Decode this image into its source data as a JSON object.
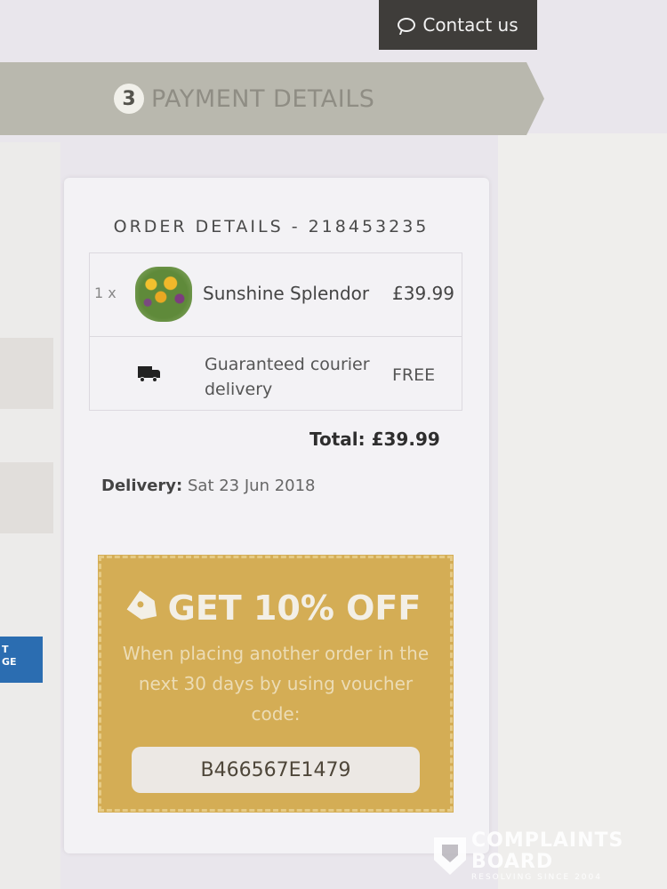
{
  "header": {
    "contact_button": "Contact us",
    "step_number": "3",
    "step_title": "PAYMENT DETAILS"
  },
  "order": {
    "title": "ORDER DETAILS - 218453235",
    "items": [
      {
        "qty": "1 x",
        "name": "Sunshine Splendor",
        "price": "£39.99"
      }
    ],
    "delivery_line": {
      "name": "Guaranteed courier delivery",
      "price": "FREE"
    },
    "total": "Total: £39.99",
    "delivery_label": "Delivery:",
    "delivery_date": "Sat 23 Jun 2018"
  },
  "voucher": {
    "headline": "GET 10% OFF",
    "text": "When placing another order in the next 30 days by using voucher code:",
    "code": "B466567E1479"
  },
  "side_badge": {
    "line1": "T",
    "line2": "GE"
  },
  "watermark": {
    "brand_line1": "COMPLAINTS",
    "brand_line2": "BOARD",
    "tagline": "RESOLVING SINCE 2004"
  },
  "colors": {
    "banner": "#b9b8ae",
    "contact_button_bg": "#3f3d3a",
    "voucher_bg": "#d4ad55",
    "badge_blue": "#2b6db1"
  }
}
